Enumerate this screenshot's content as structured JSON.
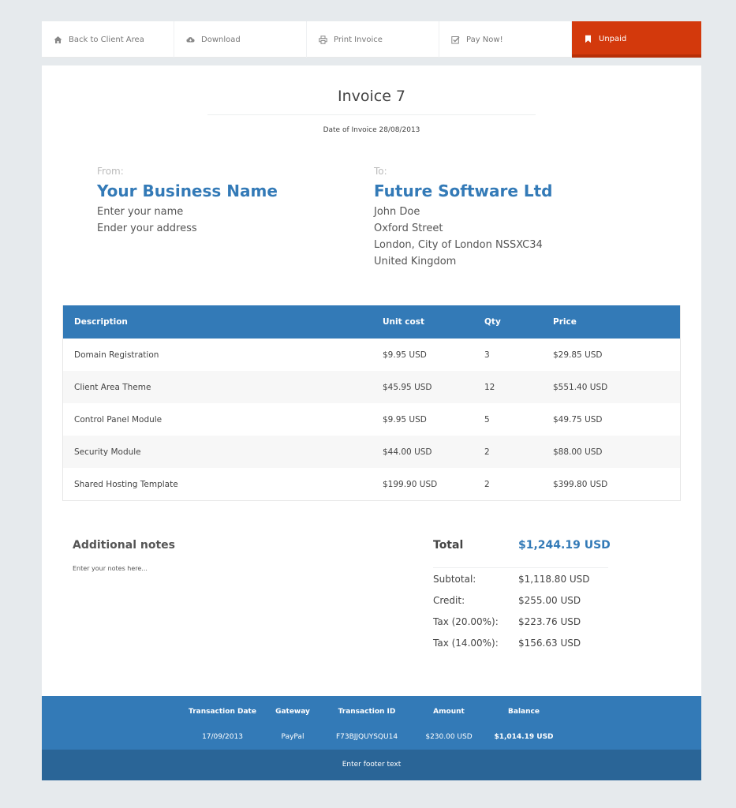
{
  "nav": {
    "items": [
      {
        "label": "Back to Client Area",
        "icon": "home-icon"
      },
      {
        "label": "Download",
        "icon": "cloud-download-icon"
      },
      {
        "label": "Print Invoice",
        "icon": "printer-icon"
      },
      {
        "label": "Pay Now!",
        "icon": "check-square-icon"
      },
      {
        "label": "Unpaid",
        "icon": "bookmark-icon"
      }
    ],
    "status_color": "#d3390c"
  },
  "invoice": {
    "title": "Invoice 7",
    "date_line": "Date of Invoice 28/08/2013"
  },
  "from": {
    "label": "From:",
    "name": "Your Business Name",
    "lines": [
      "Enter your name",
      "Ender your address"
    ]
  },
  "to": {
    "label": "To:",
    "name": "Future Software Ltd",
    "lines": [
      "John Doe",
      "Oxford Street",
      "London, City of London NSSXC34",
      "United Kingdom"
    ]
  },
  "items": {
    "headers": [
      "Description",
      "Unit cost",
      "Qty",
      "Price"
    ],
    "rows": [
      [
        "Domain Registration",
        "$9.95 USD",
        "3",
        "$29.85 USD"
      ],
      [
        "Client Area Theme",
        "$45.95 USD",
        "12",
        "$551.40 USD"
      ],
      [
        "Control Panel Module",
        "$9.95 USD",
        "5",
        "$49.75 USD"
      ],
      [
        "Security Module",
        "$44.00 USD",
        "2",
        "$88.00 USD"
      ],
      [
        "Shared Hosting Template",
        "$199.90 USD",
        "2",
        "$399.80 USD"
      ]
    ]
  },
  "notes": {
    "heading": "Additional notes",
    "text": "Enter your notes here..."
  },
  "totals": {
    "total_label": "Total",
    "total_value": "$1,244.19 USD",
    "lines": [
      {
        "label": "Subtotal:",
        "value": "$1,118.80 USD"
      },
      {
        "label": "Credit:",
        "value": "$255.00 USD"
      },
      {
        "label": "Tax (20.00%):",
        "value": "$223.76 USD"
      },
      {
        "label": "Tax (14.00%):",
        "value": "$156.63 USD"
      }
    ]
  },
  "transactions": {
    "headers": [
      "Transaction Date",
      "Gateway",
      "Transaction ID",
      "Amount",
      "Balance"
    ],
    "row": [
      "17/09/2013",
      "PayPal",
      "F73BJJQUYSQU14",
      "$230.00 USD",
      "$1,014.19 USD"
    ]
  },
  "footer": {
    "text": "Enter footer text"
  },
  "colors": {
    "accent": "#337ab7",
    "footer_dark": "#2a6597",
    "background": "#e6eaed"
  }
}
